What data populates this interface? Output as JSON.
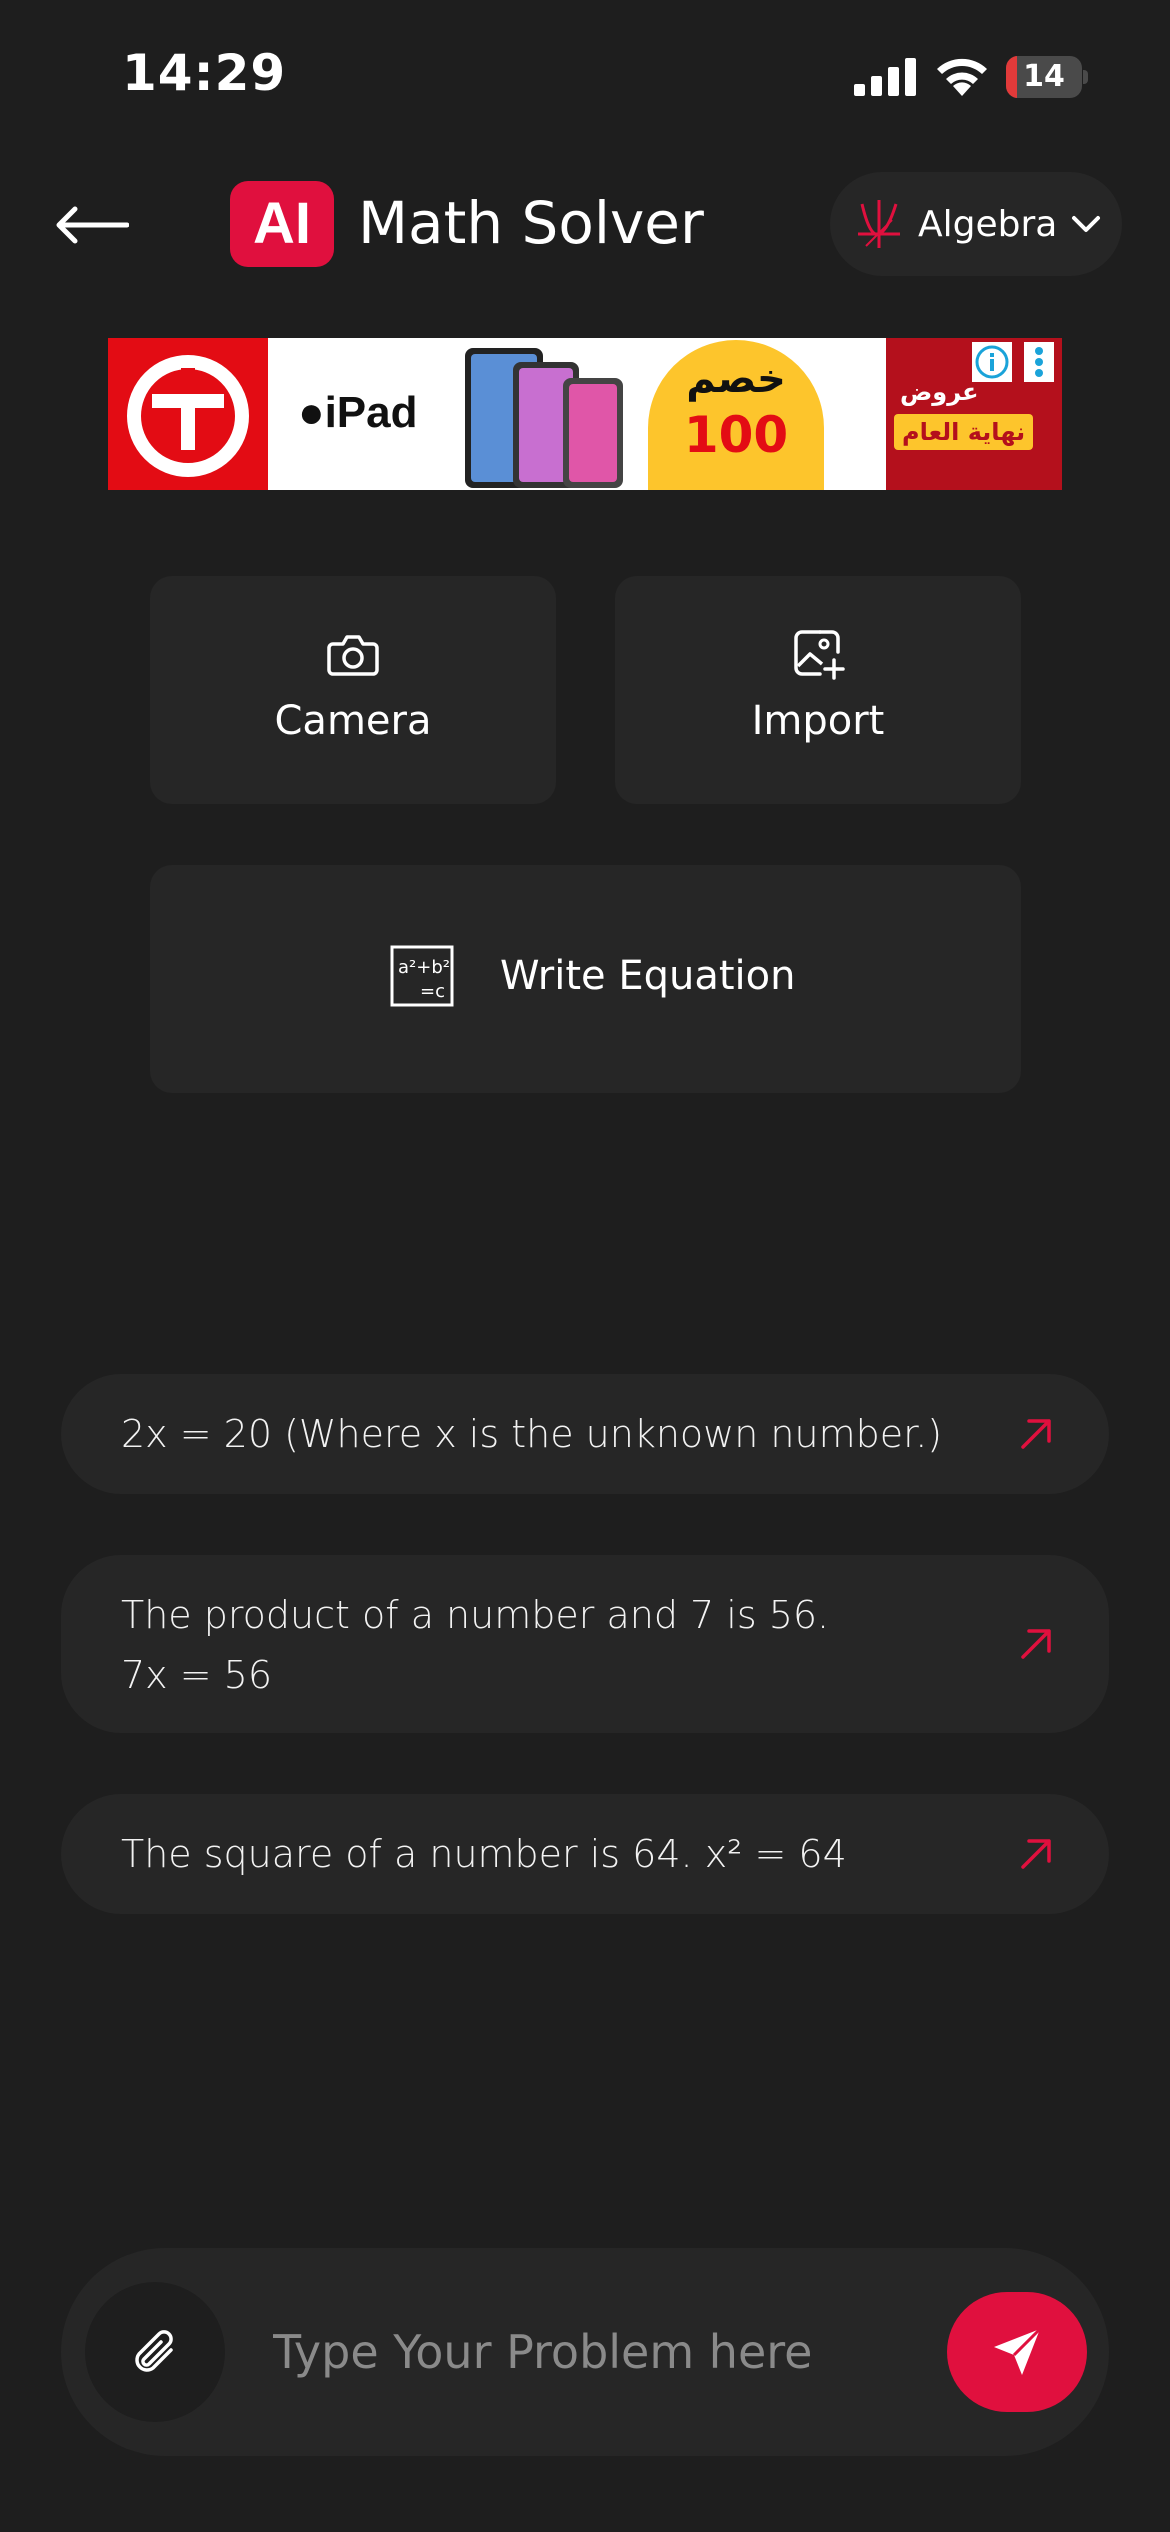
{
  "status_bar": {
    "time": "14:29",
    "battery_level": "14",
    "battery_fraction": 0.14,
    "battery_color": "#e23a3a"
  },
  "header": {
    "back_icon": "arrow-left-icon",
    "logo_text": "AI",
    "title": "Math Solver",
    "subject": {
      "selected": "Algebra",
      "icon": "graph-axes-icon",
      "chevron_icon": "chevron-down-icon"
    }
  },
  "ad": {
    "brand_text": "iPad",
    "discount_label": "خصم",
    "discount_amount": "100",
    "offer_line_1": "عروض",
    "offer_line_2": "نهاية العام"
  },
  "actions": {
    "camera": {
      "label": "Camera",
      "icon": "camera-icon"
    },
    "import": {
      "label": "Import",
      "icon": "image-add-icon"
    },
    "write": {
      "label": "Write Equation",
      "icon": "equation-icon"
    }
  },
  "suggestions": [
    {
      "text": "2x = 20 (Where x is the unknown number.)",
      "icon": "arrow-up-right-icon"
    },
    {
      "text": "The product of a number and 7 is 56.\n7x = 56",
      "icon": "arrow-up-right-icon"
    },
    {
      "text": "The square of a number is 64. x² = 64",
      "icon": "arrow-up-right-icon"
    }
  ],
  "composer": {
    "placeholder": "Type Your Problem here",
    "value": "",
    "attach_icon": "paperclip-icon",
    "send_icon": "send-icon"
  },
  "colors": {
    "background": "#1e1e1e",
    "surface": "#262626",
    "accent": "#e0103e"
  }
}
